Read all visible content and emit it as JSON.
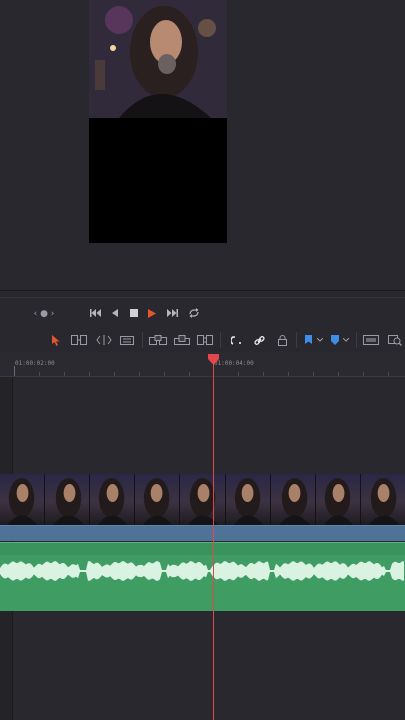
{
  "viewer": {
    "description_hidden": ""
  },
  "transport": {
    "nav_dots": "‹ ● ›",
    "buttons": [
      "skip-to-start",
      "step-back",
      "stop",
      "play",
      "skip-to-end",
      "loop"
    ]
  },
  "edit_toolbar": {
    "tools": [
      "selection-mode",
      "trim-edit-mode",
      "dynamic-trim-mode",
      "blade-edit-mode",
      "insert-clip",
      "overwrite-clip",
      "replace-clip",
      "snapping",
      "linked-selection",
      "position-lock",
      "flag",
      "marker",
      "zoom-full",
      "zoom-detail"
    ]
  },
  "ruler": {
    "labels": [
      "01:00:02:00",
      "01:00:04:00"
    ]
  },
  "colors": {
    "playhead": "#e5464b",
    "video_clip_bar": "#4e7396",
    "audio_clip": "#3f9d63",
    "waveform": "#d9f2e1",
    "play_button": "#e5562f",
    "accent_blue": "#3d8fe6"
  }
}
